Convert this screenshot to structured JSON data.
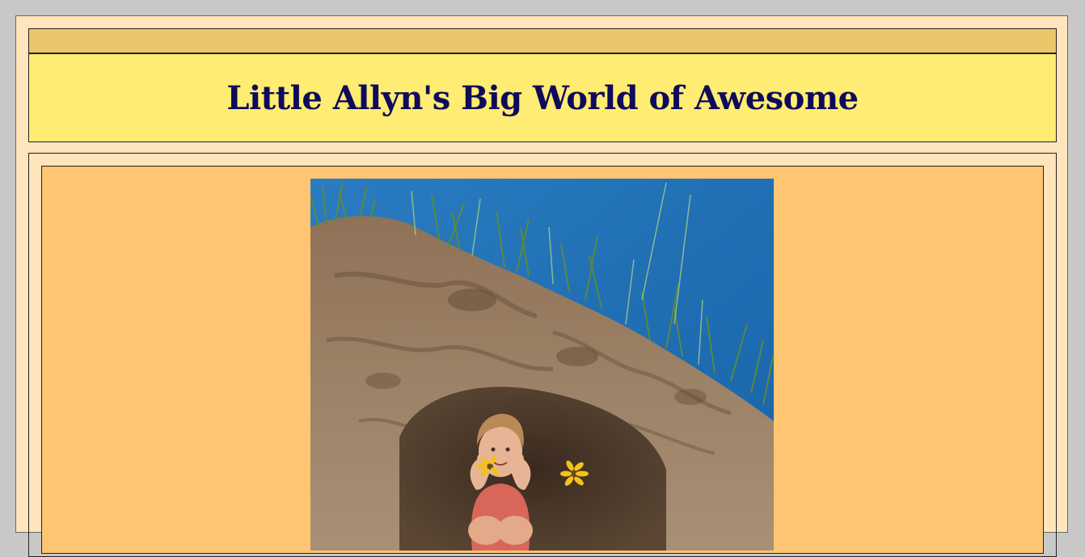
{
  "page": {
    "title": "Little Allyn's Big World of Awesome"
  },
  "header": {
    "strip_color": "#e8c669",
    "background_color": "#ffec72",
    "title_color": "#0e0b5a"
  },
  "content": {
    "background_color": "#ffc573",
    "photo": {
      "subject": "child-sitting-in-sand-cave-photo",
      "sky_color": "#1e6fb6",
      "sand_color": "#8f7258",
      "grass_color": "#5f8a3a",
      "flower_color": "#f2c21b"
    }
  }
}
